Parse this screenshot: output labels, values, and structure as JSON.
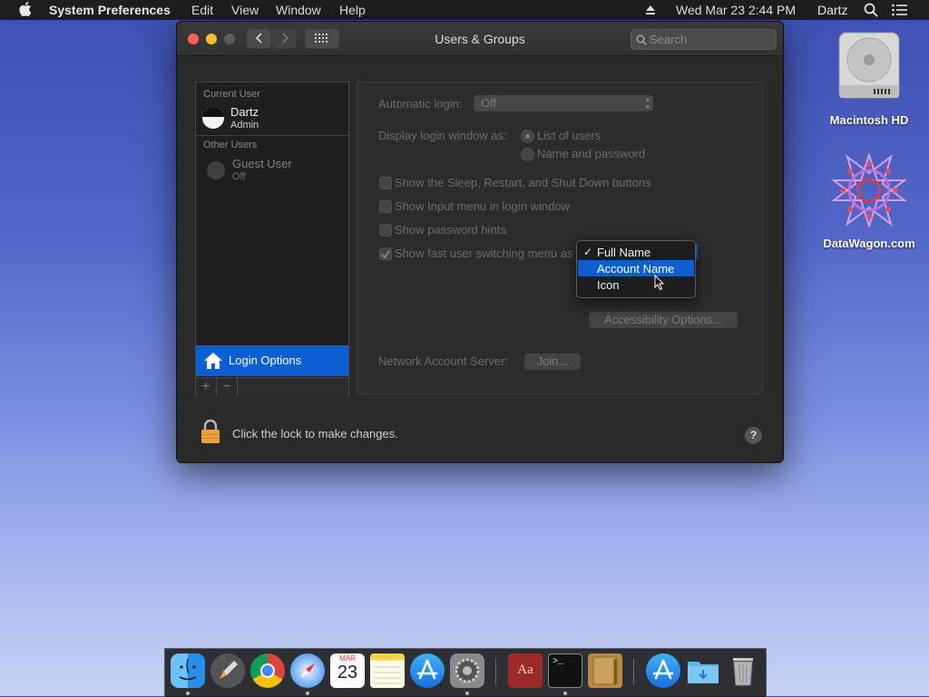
{
  "menubar": {
    "app_name": "System Preferences",
    "menus": [
      "Edit",
      "View",
      "Window",
      "Help"
    ],
    "datetime": "Wed Mar 23  2:44 PM",
    "user": "Dartz"
  },
  "window": {
    "title": "Users & Groups",
    "search_placeholder": "Search"
  },
  "users": {
    "current_header": "Current User",
    "current": {
      "name": "Dartz",
      "role": "Admin"
    },
    "other_header": "Other Users",
    "guest": {
      "name": "Guest User",
      "status": "Off"
    },
    "login_options_label": "Login Options"
  },
  "panel": {
    "auto_login_label": "Automatic login:",
    "auto_login_value": "Off",
    "display_login_label": "Display login window as:",
    "radio_list": "List of users",
    "radio_name": "Name and password",
    "chk_sleep": "Show the Sleep, Restart, and Shut Down buttons",
    "chk_input": "Show Input menu in login window",
    "chk_hints": "Show password hints",
    "chk_fast": "Show fast user switching menu as",
    "accessibility_button": "Accessibility Options...",
    "network_label": "Network Account Server:",
    "join_button": "Join..."
  },
  "dropdown": {
    "items": [
      {
        "label": "Full Name",
        "checked": true,
        "highlighted": false
      },
      {
        "label": "Account Name",
        "checked": false,
        "highlighted": true
      },
      {
        "label": "Icon",
        "checked": false,
        "highlighted": false
      }
    ]
  },
  "footer": {
    "lock_text": "Click the lock to make changes.",
    "help": "?"
  },
  "desktop": {
    "icons": [
      {
        "label": "Macintosh HD",
        "icon": "hard-drive-icon"
      },
      {
        "label": "DataWagon.com",
        "icon": "mandala-icon"
      }
    ]
  },
  "dock": {
    "apps": [
      "finder-icon",
      "launchpad-icon",
      "chrome-icon",
      "safari-icon",
      "calendar-icon",
      "notes-icon",
      "app-store-icon",
      "system-preferences-icon",
      "dictionary-icon",
      "terminal-icon",
      "script-editor-icon",
      "app-store-downloads-icon",
      "folder-icon",
      "trash-icon"
    ],
    "calendar_month": "MAR",
    "calendar_day": "23",
    "dictionary_text": "Aa",
    "terminal_prompt": ">_"
  },
  "colors": {
    "accent": "#0b5fd3",
    "window_bg": "#2a2a2a",
    "menubar_bg": "#1e1e1e"
  }
}
